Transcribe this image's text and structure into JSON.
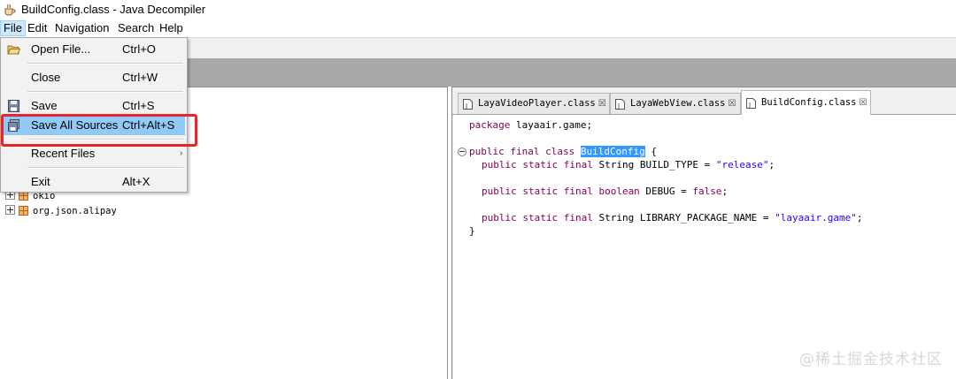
{
  "window": {
    "title": "BuildConfig.class - Java Decompiler",
    "app_icon": "coffee-cup-icon"
  },
  "menubar": {
    "file": "File",
    "edit": "Edit",
    "navigation": "Navigation",
    "search": "Search",
    "help": "Help"
  },
  "file_menu": {
    "items": [
      {
        "label": "Open File...",
        "accel": "Ctrl+O",
        "icon": "open-folder-icon"
      },
      {
        "label": "Close",
        "accel": "Ctrl+W"
      },
      {
        "label": "Save",
        "accel": "Ctrl+S",
        "icon": "floppy-disk-icon"
      },
      {
        "label": "Save All Sources",
        "accel": "Ctrl+Alt+S",
        "icon": "save-all-icon"
      },
      {
        "label": "Recent Files",
        "accel": "",
        "submenu_arrow": "›"
      },
      {
        "label": "Exit",
        "accel": "Alt+X"
      }
    ]
  },
  "tree": {
    "items": [
      {
        "label": "okio"
      },
      {
        "label": "org.json.alipay"
      }
    ]
  },
  "tabs": [
    {
      "label": "LayaVideoPlayer.class",
      "close": "☒"
    },
    {
      "label": "LayaWebView.class",
      "close": "☒"
    },
    {
      "label": "BuildConfig.class",
      "close": "☒",
      "active": true
    }
  ],
  "code": {
    "package_kw": "package",
    "package_name": " layaair.game;",
    "class_kw": "public final class",
    "class_name": "BuildConfig",
    "class_open": " {",
    "f1_kw": "public static final",
    "f1_type": " String BUILD_TYPE = ",
    "f1_val": "\"release\"",
    "f1_end": ";",
    "f2_kw": "public static final boolean",
    "f2_rest": " DEBUG = ",
    "f2_val": "false",
    "f2_end": ";",
    "f3_kw": "public static final",
    "f3_type": " String LIBRARY_PACKAGE_NAME = ",
    "f3_val": "\"layaair.game\"",
    "f3_end": ";",
    "close_brace": "}"
  },
  "watermark": "@稀土掘金技术社区",
  "colors": {
    "keyword": "#7f0055",
    "string": "#2a00ff",
    "selection": "#3399ff",
    "menu_highlight": "#91c9f7",
    "annotation_box": "#e8252a"
  }
}
